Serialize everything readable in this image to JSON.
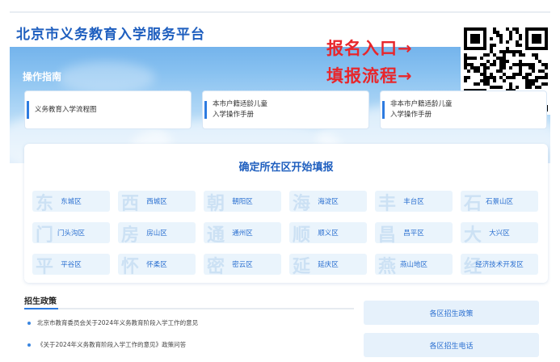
{
  "site": {
    "title": "北京市义务教育入学服务平台"
  },
  "overlay": {
    "line1": "报名入口→",
    "line2": "填报流程→"
  },
  "guide": {
    "title": "操作指南",
    "cards": [
      {
        "line1": "义务教育入学流程图",
        "line2": ""
      },
      {
        "line1": "本市户籍适龄儿童",
        "line2": "入学操作手册"
      },
      {
        "line1": "非本市户籍适龄儿童",
        "line2": "入学操作手册"
      }
    ]
  },
  "districts": {
    "heading": "确定所在区开始填报",
    "items": [
      {
        "ghost": "东",
        "label": "东城区"
      },
      {
        "ghost": "西",
        "label": "西城区"
      },
      {
        "ghost": "朝",
        "label": "朝阳区"
      },
      {
        "ghost": "海",
        "label": "海淀区"
      },
      {
        "ghost": "丰",
        "label": "丰台区"
      },
      {
        "ghost": "石",
        "label": "石景山区"
      },
      {
        "ghost": "门",
        "label": "门头沟区"
      },
      {
        "ghost": "房",
        "label": "房山区"
      },
      {
        "ghost": "通",
        "label": "通州区"
      },
      {
        "ghost": "顺",
        "label": "顺义区"
      },
      {
        "ghost": "昌",
        "label": "昌平区"
      },
      {
        "ghost": "大",
        "label": "大兴区"
      },
      {
        "ghost": "平",
        "label": "平谷区"
      },
      {
        "ghost": "怀",
        "label": "怀柔区"
      },
      {
        "ghost": "密",
        "label": "密云区"
      },
      {
        "ghost": "延",
        "label": "延庆区"
      },
      {
        "ghost": "燕",
        "label": "燕山地区"
      },
      {
        "ghost": "经",
        "label": "经济技术开发区"
      }
    ]
  },
  "policy": {
    "title": "招生政策",
    "items": [
      "北京市教育委员会关于2024年义务教育阶段入学工作的意见",
      "《关于2024年义务教育阶段入学工作的意见》政策问答"
    ]
  },
  "side_buttons": {
    "policy": "各区招生政策",
    "phone": "各区招生电话"
  },
  "colors": {
    "brand": "#1f5fbf",
    "accent_red": "#e8262b",
    "tile_bg": "#eaf4fc"
  }
}
